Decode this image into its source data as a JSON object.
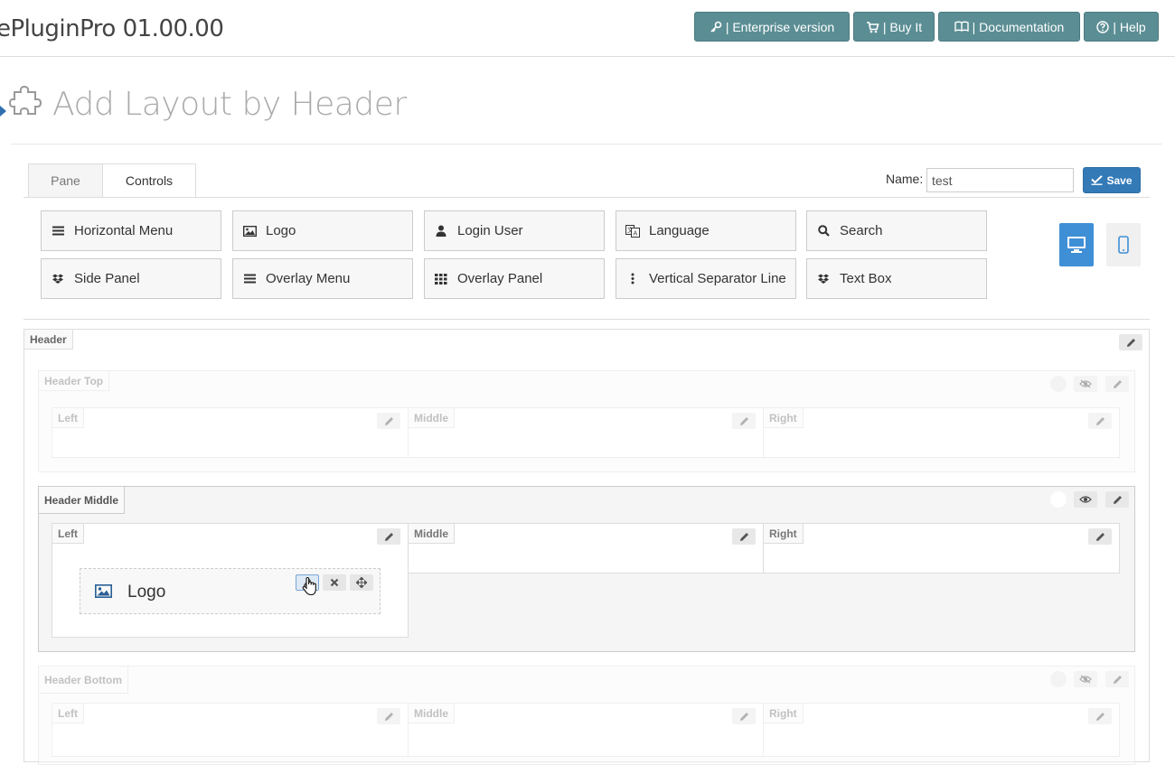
{
  "app": {
    "title": "ePluginPro 01.00.00"
  },
  "top_buttons": [
    {
      "label": "| Enterprise version",
      "icon": "key-icon"
    },
    {
      "label": "| Buy It",
      "icon": "cart-icon"
    },
    {
      "label": "| Documentation",
      "icon": "book-icon"
    },
    {
      "label": "| Help",
      "icon": "question-icon"
    }
  ],
  "page": {
    "title": "Add Layout by Header",
    "icon": "puzzle-icon"
  },
  "tabs": [
    {
      "label": "Pane"
    },
    {
      "label": "Controls"
    }
  ],
  "form": {
    "name_label": "Name:",
    "name_value": "test",
    "save_label": "Save"
  },
  "controls": [
    {
      "label": "Horizontal Menu",
      "icon": "bars-icon"
    },
    {
      "label": "Logo",
      "icon": "image-icon"
    },
    {
      "label": "Login User",
      "icon": "user-icon"
    },
    {
      "label": "Language",
      "icon": "translate-icon"
    },
    {
      "label": "Search",
      "icon": "search-icon"
    },
    {
      "label": "Side Panel",
      "icon": "dropbox-icon"
    },
    {
      "label": "Overlay Menu",
      "icon": "bars-icon"
    },
    {
      "label": "Overlay Panel",
      "icon": "grid-icon"
    },
    {
      "label": "Vertical Separator Line",
      "icon": "vertical-dots-icon"
    },
    {
      "label": "Text Box",
      "icon": "dropbox-icon"
    }
  ],
  "devices": [
    {
      "icon": "desktop-icon",
      "active": true
    },
    {
      "icon": "mobile-icon",
      "active": false
    }
  ],
  "header": {
    "label": "Header",
    "sections": [
      {
        "label": "Header Top",
        "columns": [
          "Left",
          "Middle",
          "Right"
        ]
      },
      {
        "label": "Header Middle",
        "columns": [
          "Left",
          "Middle",
          "Right"
        ]
      },
      {
        "label": "Header Bottom",
        "columns": [
          "Left",
          "Middle",
          "Right"
        ]
      }
    ],
    "placed_item": {
      "label": "Logo",
      "icon": "image-icon"
    }
  },
  "colors": {
    "accent": "#5b8e94",
    "primary": "#337ab7",
    "device_active": "#3f8fd6"
  }
}
